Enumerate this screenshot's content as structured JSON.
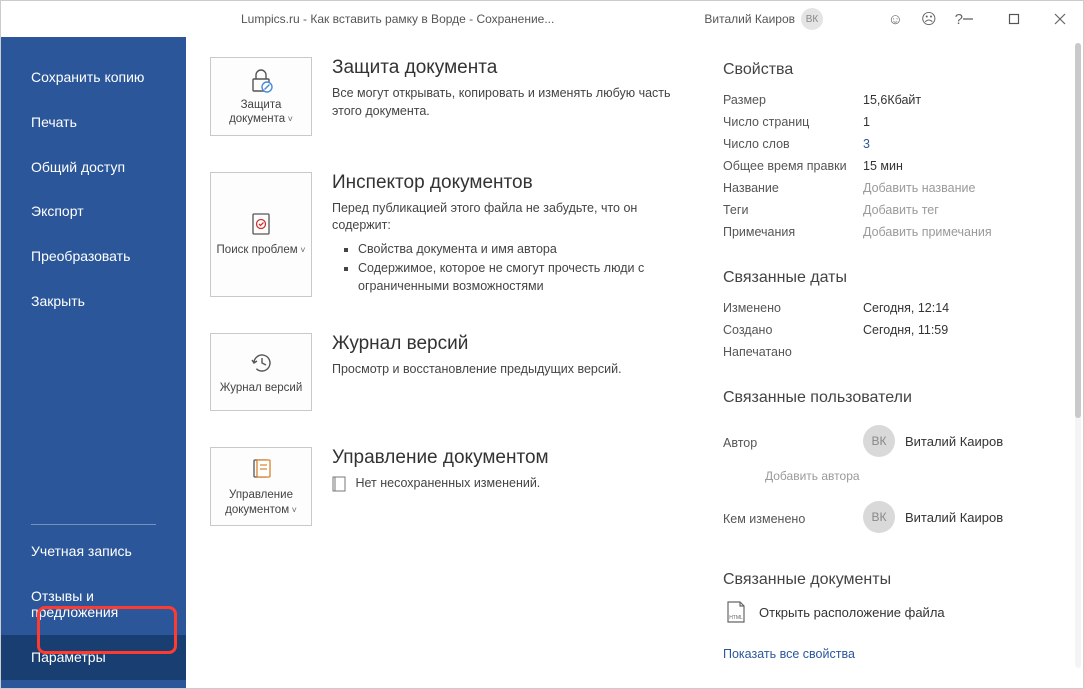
{
  "titlebar": {
    "title": "Lumpics.ru - Как вставить рамку в Ворде  -  Сохранение...",
    "user_name": "Виталий Каиров",
    "user_initials": "ВК"
  },
  "sidebar": {
    "items": [
      {
        "label": "Сохранить копию"
      },
      {
        "label": "Печать"
      },
      {
        "label": "Общий доступ"
      },
      {
        "label": "Экспорт"
      },
      {
        "label": "Преобразовать"
      },
      {
        "label": "Закрыть"
      }
    ],
    "footer": [
      {
        "label": "Учетная запись"
      },
      {
        "label": "Отзывы и предложения"
      },
      {
        "label": "Параметры"
      }
    ]
  },
  "center": {
    "protect": {
      "btn": "Защита документа",
      "heading": "Защита документа",
      "text": "Все могут открывать, копировать и изменять любую часть этого документа."
    },
    "inspect": {
      "btn": "Поиск проблем",
      "heading": "Инспектор документов",
      "text": "Перед публикацией этого файла не забудьте, что он содержит:",
      "items": [
        "Свойства документа и имя автора",
        "Содержимое, которое не смогут прочесть люди с ограниченными возможностями"
      ]
    },
    "history": {
      "btn": "Журнал версий",
      "heading": "Журнал версий",
      "text": "Просмотр и восстановление предыдущих версий."
    },
    "manage": {
      "btn": "Управление документом",
      "heading": "Управление документом",
      "text": "Нет несохраненных изменений."
    }
  },
  "right": {
    "properties_heading": "Свойства",
    "props": {
      "size_k": "Размер",
      "size_v": "15,6Кбайт",
      "pages_k": "Число страниц",
      "pages_v": "1",
      "words_k": "Число слов",
      "words_v": "3",
      "edit_time_k": "Общее время правки",
      "edit_time_v": "15 мин",
      "title_k": "Название",
      "title_v": "Добавить название",
      "tags_k": "Теги",
      "tags_v": "Добавить тег",
      "comments_k": "Примечания",
      "comments_v": "Добавить примечания"
    },
    "dates_heading": "Связанные даты",
    "dates": {
      "modified_k": "Изменено",
      "modified_v": "Сегодня, 12:14",
      "created_k": "Создано",
      "created_v": "Сегодня, 11:59",
      "printed_k": "Напечатано",
      "printed_v": ""
    },
    "users_heading": "Связанные пользователи",
    "users": {
      "author_k": "Автор",
      "author_initials": "ВК",
      "author_name": "Виталий Каиров",
      "add_author": "Добавить автора",
      "modifier_k": "Кем изменено",
      "modifier_initials": "ВК",
      "modifier_name": "Виталий Каиров"
    },
    "docs_heading": "Связанные документы",
    "open_location": "Открыть расположение файла",
    "show_all": "Показать все свойства"
  }
}
